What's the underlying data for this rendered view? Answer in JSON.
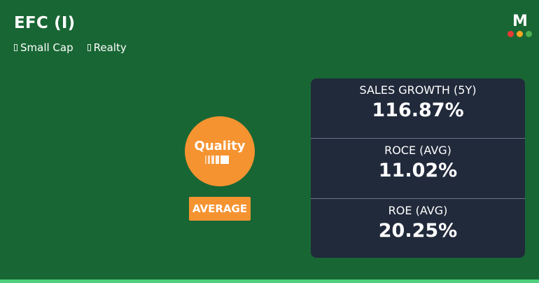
{
  "header": {
    "title": "EFC (I)",
    "tags": [
      {
        "label": "Small Cap",
        "icon": "box-icon"
      },
      {
        "label": "Realty",
        "icon": "box-icon"
      }
    ]
  },
  "logo": {
    "letter": "M",
    "dot_colors": [
      "#e53935",
      "#f5a623",
      "#4caf50"
    ]
  },
  "quality": {
    "label": "Quality",
    "rating": "AVERAGE",
    "color": "#f59331"
  },
  "metrics": [
    {
      "label": "SALES GROWTH (5Y)",
      "value": "116.87%"
    },
    {
      "label": "ROCE (AVG)",
      "value": "11.02%"
    },
    {
      "label": "ROE (AVG)",
      "value": "20.25%"
    }
  ],
  "colors": {
    "background": "#186634",
    "panel": "#212a3b",
    "accent": "#f59331",
    "bottom_bar": "#4ed07d"
  }
}
